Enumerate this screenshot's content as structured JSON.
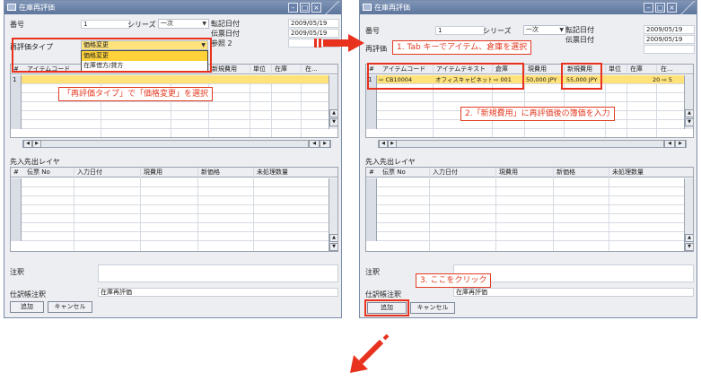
{
  "left": {
    "title": "在庫再評価",
    "labels": {
      "number": "番号",
      "series": "シリーズ",
      "posting_date": "転記日付",
      "doc_date": "伝票日付",
      "ref2": "参照 2",
      "reval_type": "再評価タイプ",
      "fifo_layer": "先入先出レイヤ",
      "remarks": "注釈",
      "journal_remarks": "仕訳帳注釈"
    },
    "values": {
      "number": "1",
      "series": "一次",
      "posting_date": "2009/05/19",
      "doc_date": "2009/05/19",
      "reval_type": "価格変更",
      "journal_remarks": "在庫再評価"
    },
    "dropdown_options": [
      "価格変更",
      "在庫借方/貸方"
    ],
    "grid_headers": [
      "#",
      "アイテムコード",
      "新規費用",
      "単位",
      "在庫",
      "在..."
    ],
    "grid_rows": [
      "1"
    ],
    "fifo_headers": [
      "#",
      "伝票 No",
      "入力日付",
      "現費用",
      "新価格",
      "未処理数量"
    ],
    "buttons": {
      "add": "追加",
      "cancel": "キャンセル"
    }
  },
  "right": {
    "title": "在庫再評価",
    "labels": {
      "number": "番号",
      "series": "シリーズ",
      "posting_date": "転記日付",
      "doc_date": "伝票日付",
      "reval": "再評価",
      "fifo_layer": "先入先出レイヤ",
      "remarks": "注釈",
      "journal_remarks": "仕訳帳注釈"
    },
    "values": {
      "number": "1",
      "series": "一次",
      "posting_date": "2009/05/19",
      "doc_date": "2009/05/19",
      "journal_remarks": "在庫再評価"
    },
    "grid_headers": [
      "#",
      "アイテムコード",
      "アイテムテキスト",
      "倉庫",
      "現費用",
      "新規費用",
      "単位",
      "在庫",
      "在..."
    ],
    "grid_row": {
      "num": "1",
      "item_code": "⇨ CB10004",
      "item_text": "オフィスキャビネット",
      "warehouse": "⇨ 001",
      "current_cost": "50,000 JPY",
      "new_cost": "55,000 JPY",
      "stock": "20 ⇨ 5"
    },
    "fifo_headers": [
      "#",
      "伝票 No",
      "入力日付",
      "現費用",
      "新価格",
      "未処理数量"
    ],
    "buttons": {
      "add": "追加",
      "cancel": "キャンセル"
    }
  },
  "annotations": {
    "left_callout": "「再評価タイプ」で「価格変更」を選択",
    "step1": "1. Tab キーでアイテム、倉庫を選択",
    "step2": "2.「新規費用」に再評価後の簿価を入力",
    "step3": "3. ここをクリック"
  },
  "colors": {
    "accent_red": "#e8321e",
    "highlight_yellow": "#ffe27a",
    "titlebar": "#5d759c"
  }
}
